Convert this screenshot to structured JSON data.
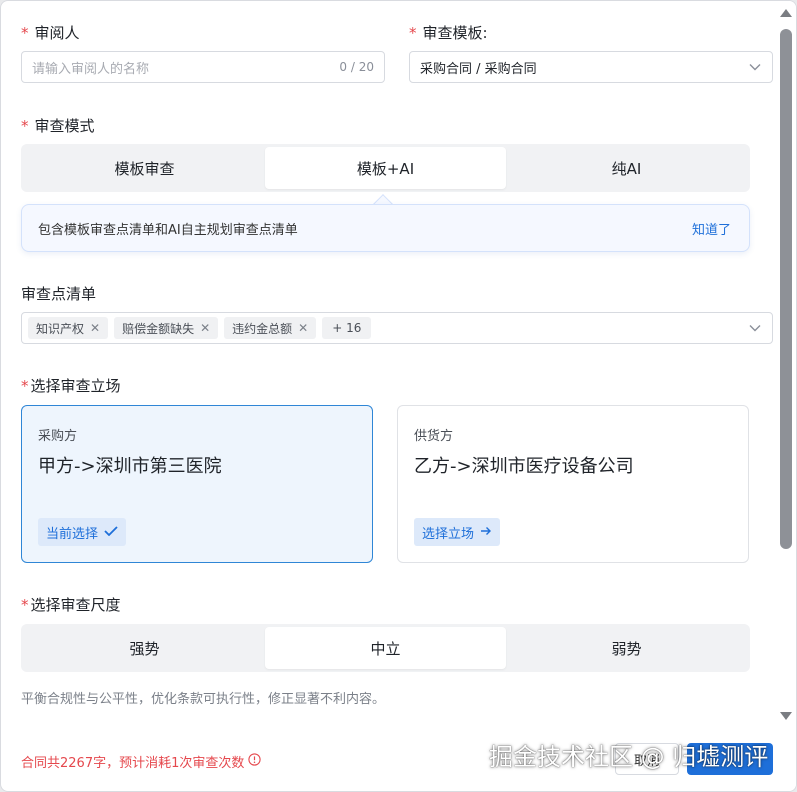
{
  "reviewer": {
    "label": "审阅人",
    "placeholder": "请输入审阅人的名称",
    "count": "0 / 20"
  },
  "template": {
    "label": "审查模板:",
    "value": "采购合同 / 采购合同"
  },
  "mode": {
    "label": "审查模式",
    "options": [
      "模板审查",
      "模板+AI",
      "纯AI"
    ],
    "selected": "模板+AI",
    "tip": "包含模板审查点清单和AI自主规划审查点清单",
    "tip_action": "知道了"
  },
  "checklist": {
    "label": "审查点清单",
    "tags": [
      "知识产权",
      "赔偿金额缺失",
      "违约金总额"
    ],
    "more": "+ 16"
  },
  "position": {
    "label": "选择审查立场",
    "cards": [
      {
        "role": "采购方",
        "party": "甲方->深圳市第三医院",
        "action": "当前选择",
        "selected": true
      },
      {
        "role": "供货方",
        "party": "乙方->深圳市医疗设备公司",
        "action": "选择立场",
        "selected": false
      }
    ]
  },
  "scale": {
    "label": "选择审查尺度",
    "options": [
      "强势",
      "中立",
      "弱势"
    ],
    "selected": "中立",
    "hint": "平衡合规性与公平性，优化条款可执行性，修正显著不利内容。"
  },
  "footer": {
    "warning": "合同共2267字，预计消耗1次审查次数",
    "cancel": "取消",
    "confirm": ""
  },
  "watermark": "掘金技术社区 @ 归墟测评",
  "colors": {
    "accent": "#1e6fd9",
    "required": "#e5484d",
    "selected_card_bg": "#eef5fd"
  }
}
